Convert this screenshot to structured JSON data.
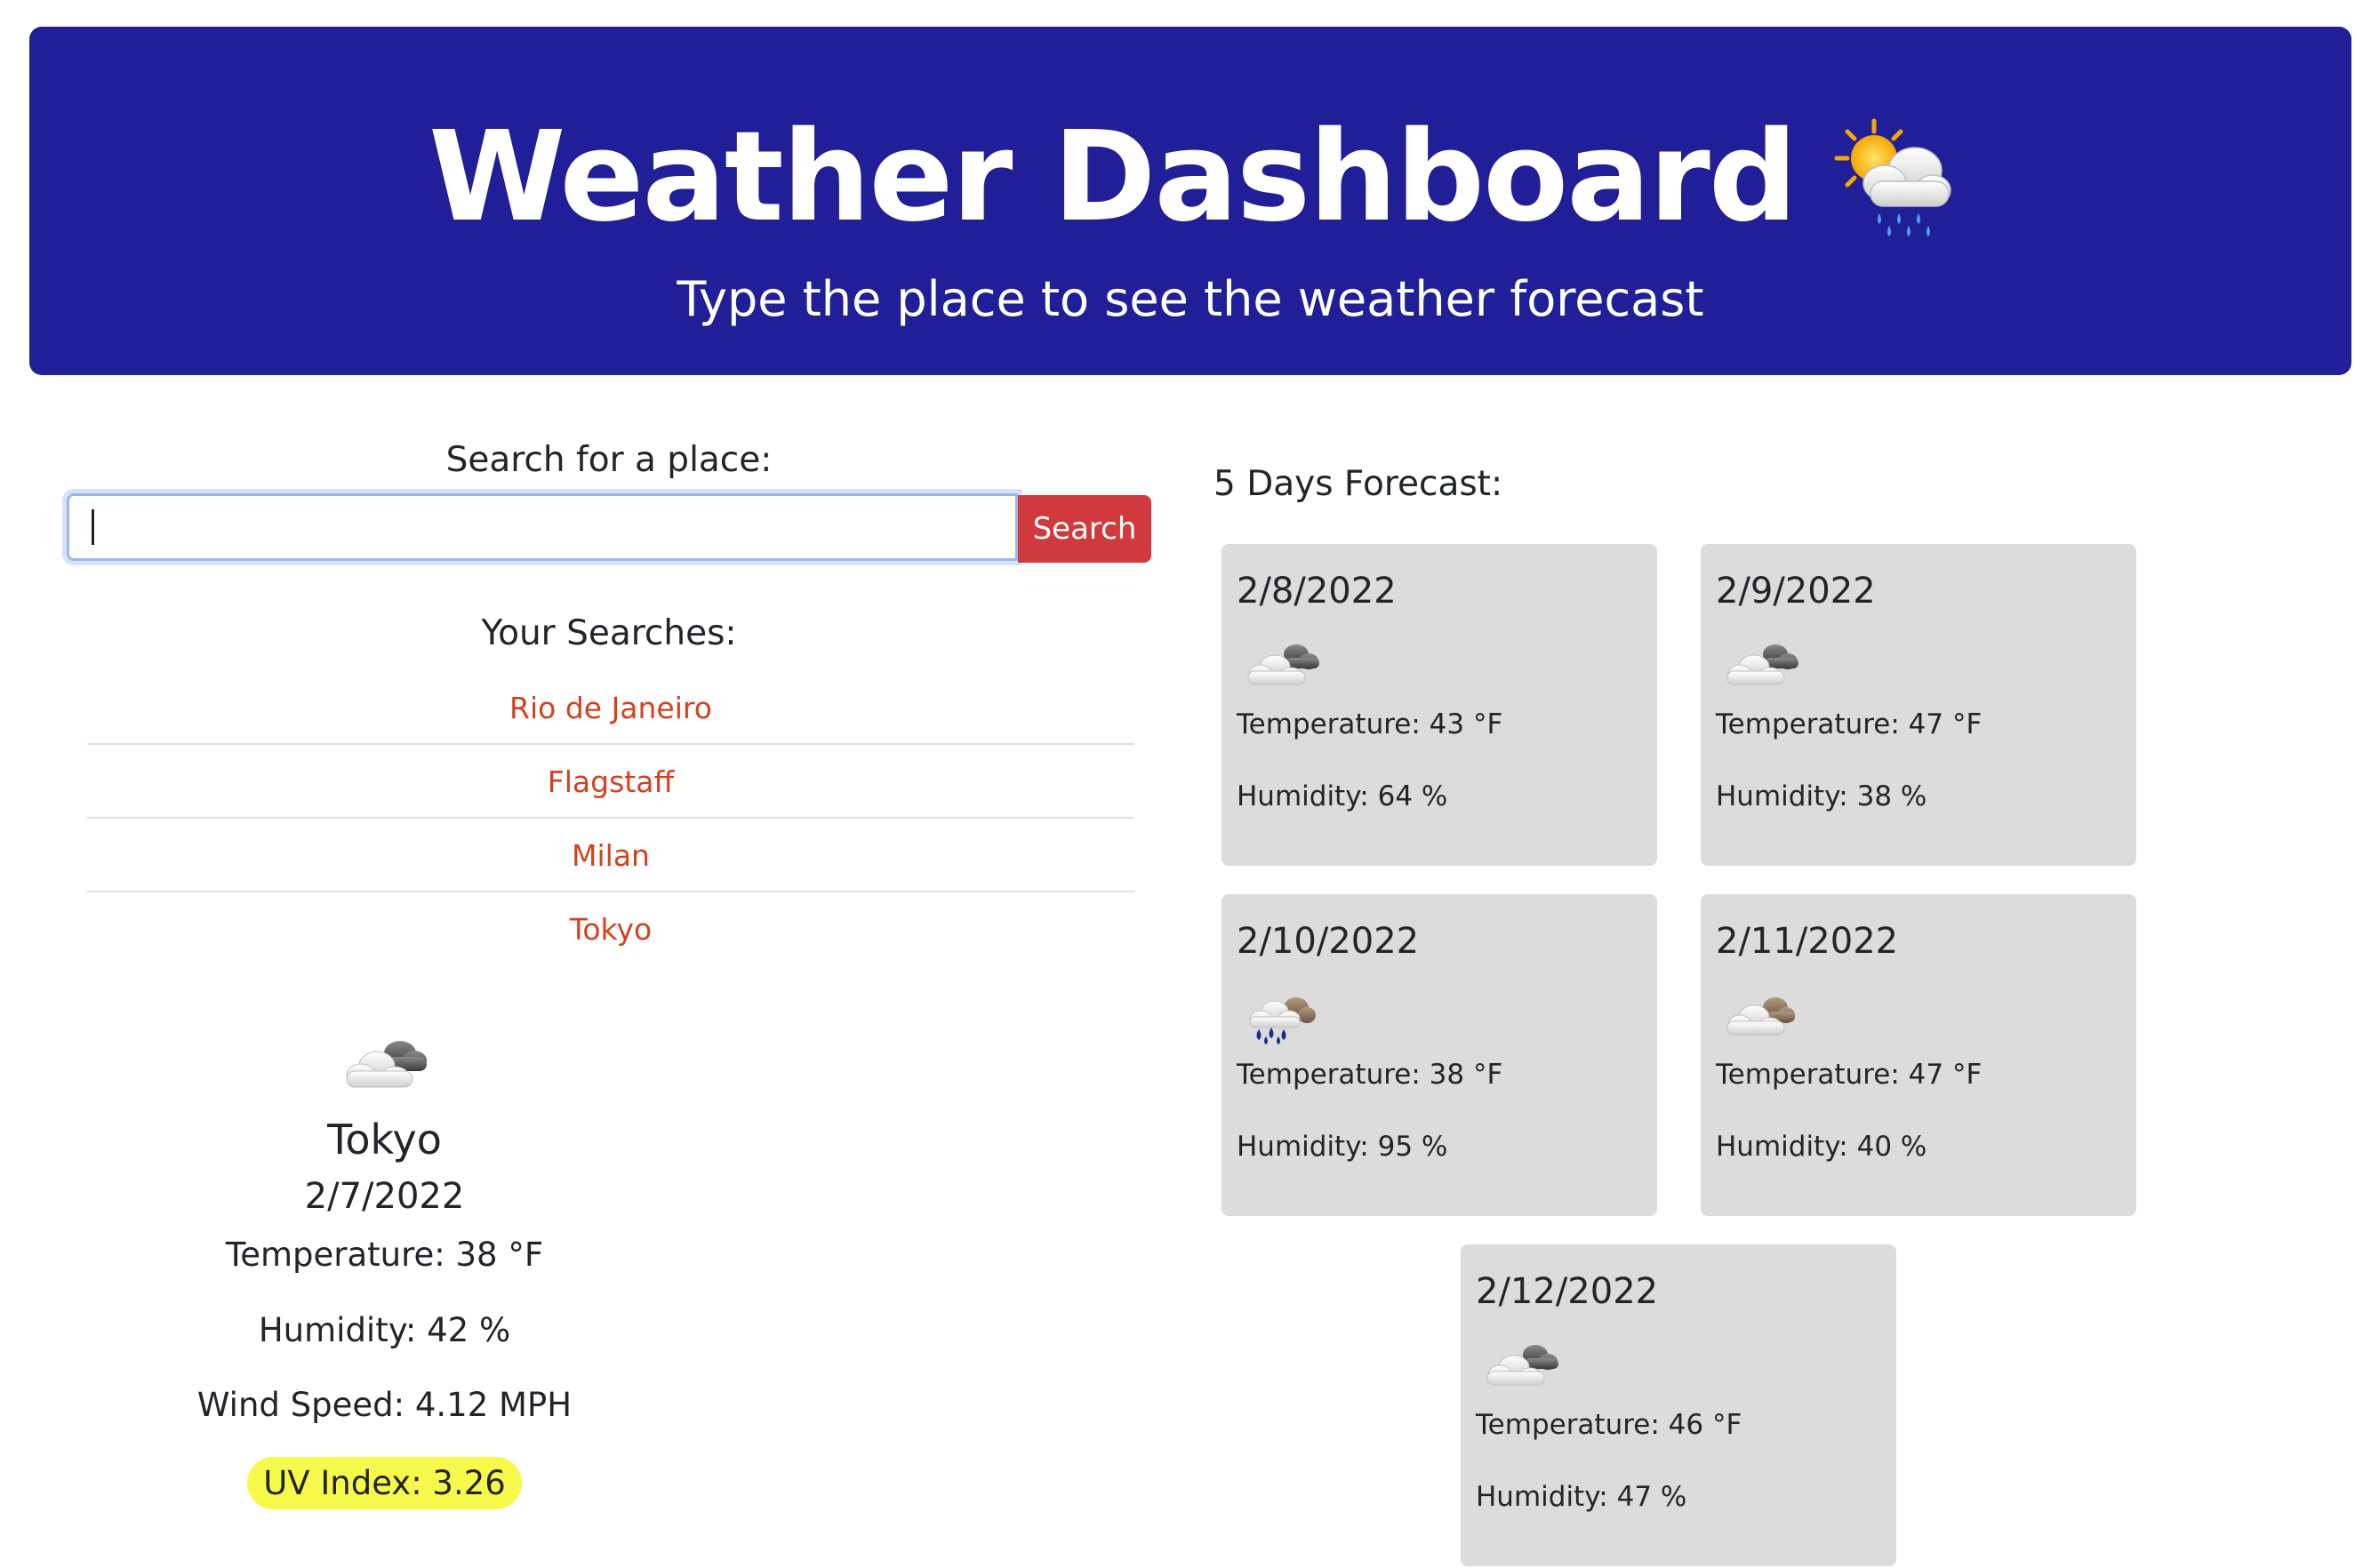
{
  "header": {
    "title": "Weather Dashboard",
    "subtitle": "Type the place to see the weather forecast",
    "emoji_icon": "sun-behind-rain-cloud-icon",
    "background": "#211f97"
  },
  "search": {
    "label": "Search for a place:",
    "value": "",
    "placeholder": "",
    "button_label": "Search",
    "button_color": "#d0393e"
  },
  "history": {
    "label": "Your Searches:",
    "items": [
      "Rio de Janeiro",
      "Flagstaff",
      "Milan",
      "Tokyo"
    ],
    "link_color": "#d2421f"
  },
  "current": {
    "icon": "cloudy-icon",
    "city": "Tokyo",
    "date": "2/7/2022",
    "temperature": "Temperature: 38 °F",
    "humidity": "Humidity: 42 %",
    "wind": "Wind Speed: 4.12 MPH",
    "uv": "UV Index: 3.26",
    "uv_color": "#f7f94a"
  },
  "forecast": {
    "label": "5 Days Forecast:",
    "days": [
      {
        "date": "2/8/2022",
        "icon": "broken-clouds-icon",
        "temperature": "Temperature: 43 °F",
        "humidity": "Humidity: 64 %"
      },
      {
        "date": "2/9/2022",
        "icon": "broken-clouds-icon",
        "temperature": "Temperature: 47 °F",
        "humidity": "Humidity: 38 %"
      },
      {
        "date": "2/10/2022",
        "icon": "rain-night-icon",
        "temperature": "Temperature: 38 °F",
        "humidity": "Humidity: 95 %"
      },
      {
        "date": "2/11/2022",
        "icon": "cloudy-night-icon",
        "temperature": "Temperature: 47 °F",
        "humidity": "Humidity: 40 %"
      },
      {
        "date": "2/12/2022",
        "icon": "broken-clouds-icon",
        "temperature": "Temperature: 46 °F",
        "humidity": "Humidity: 47 %"
      }
    ]
  }
}
